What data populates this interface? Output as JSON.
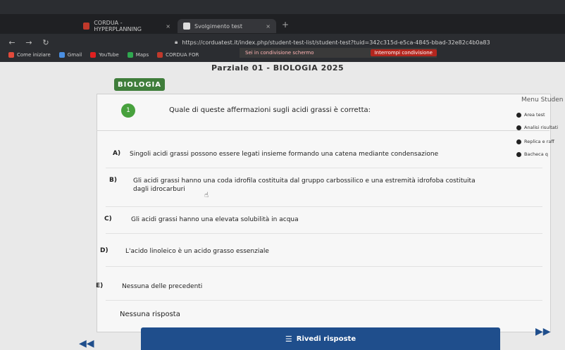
{
  "browser": {
    "tabs": [
      {
        "label": "CORDUA - HYPERPLANNING",
        "close": "×"
      },
      {
        "label": "Svolgimento test",
        "close": "×"
      }
    ],
    "new_tab": "+",
    "url": "https://corduatest.it/index.php/student-test-list/student-test?tuid=342c315d-e5ca-4845-bbad-32e82c4b0a83",
    "bookmarks": [
      "Come iniziare",
      "Gmail",
      "YouTube",
      "Maps",
      "CORDUA FOR"
    ],
    "sharing": {
      "text": "Sei in condivisione schermo",
      "stop": "Interrompi condivisione"
    }
  },
  "page": {
    "topic": "Parziale 01 - BIOLOGIA 2025",
    "subject": "BIOLOGIA",
    "question_number": "1",
    "question": "Quale di queste affermazioni sugli acidi grassi è corretta:",
    "options": [
      {
        "letter": "A)",
        "text": "Singoli acidi grassi possono essere legati insieme formando una catena mediante condensazione"
      },
      {
        "letter": "B)",
        "text": "Gli acidi grassi hanno una coda idrofila costituita dal gruppo carbossilico e una estremità idrofoba costituita dagli idrocarburi"
      },
      {
        "letter": "C)",
        "text": "Gli acidi grassi hanno una elevata solubilità in acqua"
      },
      {
        "letter": "D)",
        "text": "L'acido linoleico è un acido grasso essenziale"
      },
      {
        "letter": "E)",
        "text": "Nessuna delle precedenti"
      }
    ],
    "no_answer": "Nessuna risposta",
    "review_button": "Rivedi risposte"
  },
  "side_menu": {
    "title": "Menu Studen",
    "items": [
      "Area test",
      "Analisi risultati",
      "Replica e raff",
      "Bacheca q"
    ]
  }
}
